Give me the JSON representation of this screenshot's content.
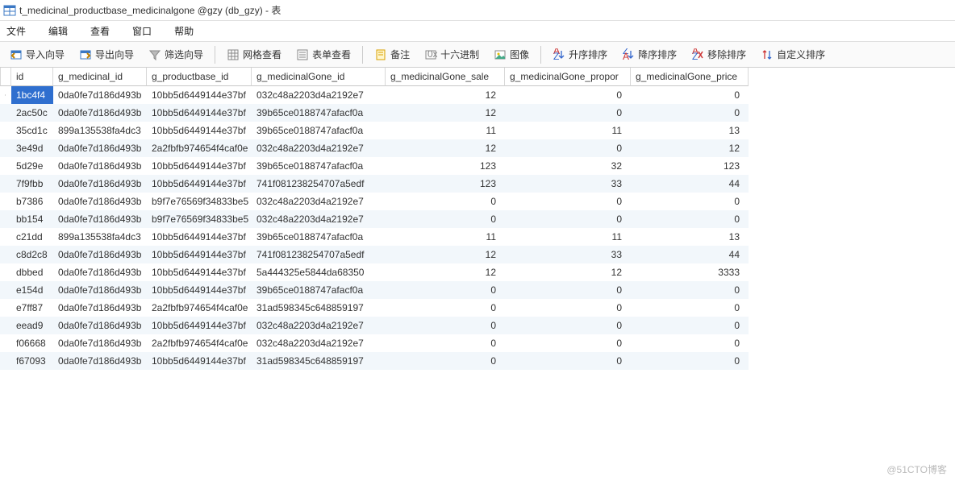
{
  "title": "t_medicinal_productbase_medicinalgone @gzy (db_gzy) - 表",
  "menu": {
    "file": "文件",
    "edit": "编辑",
    "view": "查看",
    "window": "窗口",
    "help": "帮助"
  },
  "toolbar": {
    "import": "导入向导",
    "export": "导出向导",
    "filter": "筛选向导",
    "gridview": "网格查看",
    "formview": "表单查看",
    "memo": "备注",
    "hex": "十六进制",
    "image": "图像",
    "asc": "升序排序",
    "desc": "降序排序",
    "remove_sort": "移除排序",
    "custom_sort": "自定义排序"
  },
  "columns": [
    "",
    "id",
    "g_medicinal_id",
    "g_productbase_id",
    "g_medicinalGone_id",
    "g_medicinalGone_sale",
    "g_medicinalGone_propor",
    "g_medicinalGone_price"
  ],
  "selected_cell": {
    "row": 0,
    "col": 1
  },
  "rows": [
    {
      "id": "1bc4f4",
      "g_medicinal_id": "0da0fe7d186d493b",
      "g_productbase_id": "10bb5d6449144e37bf",
      "g_medicinalGone_id": "032c48a2203d4a2192e7",
      "sale": "12",
      "propor": "0",
      "price": "0",
      "indicator": true
    },
    {
      "id": "2ac50c",
      "g_medicinal_id": "0da0fe7d186d493b",
      "g_productbase_id": "10bb5d6449144e37bf",
      "g_medicinalGone_id": "39b65ce0188747afacf0a",
      "sale": "12",
      "propor": "0",
      "price": "0"
    },
    {
      "id": "35cd1c",
      "g_medicinal_id": "899a135538fa4dc3",
      "g_productbase_id": "10bb5d6449144e37bf",
      "g_medicinalGone_id": "39b65ce0188747afacf0a",
      "sale": "11",
      "propor": "11",
      "price": "13"
    },
    {
      "id": "3e49d",
      "g_medicinal_id": "0da0fe7d186d493b",
      "g_productbase_id": "2a2fbfb974654f4caf0e",
      "g_medicinalGone_id": "032c48a2203d4a2192e7",
      "sale": "12",
      "propor": "0",
      "price": "12"
    },
    {
      "id": "5d29e",
      "g_medicinal_id": "0da0fe7d186d493b",
      "g_productbase_id": "10bb5d6449144e37bf",
      "g_medicinalGone_id": "39b65ce0188747afacf0a",
      "sale": "123",
      "propor": "32",
      "price": "123"
    },
    {
      "id": "7f9fbb",
      "g_medicinal_id": "0da0fe7d186d493b",
      "g_productbase_id": "10bb5d6449144e37bf",
      "g_medicinalGone_id": "741f081238254707a5edf",
      "sale": "123",
      "propor": "33",
      "price": "44"
    },
    {
      "id": "b7386",
      "g_medicinal_id": "0da0fe7d186d493b",
      "g_productbase_id": "b9f7e76569f34833be5",
      "g_medicinalGone_id": "032c48a2203d4a2192e7",
      "sale": "0",
      "propor": "0",
      "price": "0"
    },
    {
      "id": "bb154",
      "g_medicinal_id": "0da0fe7d186d493b",
      "g_productbase_id": "b9f7e76569f34833be5",
      "g_medicinalGone_id": "032c48a2203d4a2192e7",
      "sale": "0",
      "propor": "0",
      "price": "0"
    },
    {
      "id": "c21dd",
      "g_medicinal_id": "899a135538fa4dc3",
      "g_productbase_id": "10bb5d6449144e37bf",
      "g_medicinalGone_id": "39b65ce0188747afacf0a",
      "sale": "11",
      "propor": "11",
      "price": "13"
    },
    {
      "id": "c8d2c8",
      "g_medicinal_id": "0da0fe7d186d493b",
      "g_productbase_id": "10bb5d6449144e37bf",
      "g_medicinalGone_id": "741f081238254707a5edf",
      "sale": "12",
      "propor": "33",
      "price": "44"
    },
    {
      "id": "dbbed",
      "g_medicinal_id": "0da0fe7d186d493b",
      "g_productbase_id": "10bb5d6449144e37bf",
      "g_medicinalGone_id": "5a444325e5844da68350",
      "sale": "12",
      "propor": "12",
      "price": "3333"
    },
    {
      "id": "e154d",
      "g_medicinal_id": "0da0fe7d186d493b",
      "g_productbase_id": "10bb5d6449144e37bf",
      "g_medicinalGone_id": "39b65ce0188747afacf0a",
      "sale": "0",
      "propor": "0",
      "price": "0"
    },
    {
      "id": "e7ff87",
      "g_medicinal_id": "0da0fe7d186d493b",
      "g_productbase_id": "2a2fbfb974654f4caf0e",
      "g_medicinalGone_id": "31ad598345c648859197",
      "sale": "0",
      "propor": "0",
      "price": "0"
    },
    {
      "id": "eead9",
      "g_medicinal_id": "0da0fe7d186d493b",
      "g_productbase_id": "10bb5d6449144e37bf",
      "g_medicinalGone_id": "032c48a2203d4a2192e7",
      "sale": "0",
      "propor": "0",
      "price": "0"
    },
    {
      "id": "f06668",
      "g_medicinal_id": "0da0fe7d186d493b",
      "g_productbase_id": "2a2fbfb974654f4caf0e",
      "g_medicinalGone_id": "032c48a2203d4a2192e7",
      "sale": "0",
      "propor": "0",
      "price": "0"
    },
    {
      "id": "f67093",
      "g_medicinal_id": "0da0fe7d186d493b",
      "g_productbase_id": "10bb5d6449144e37bf",
      "g_medicinalGone_id": "31ad598345c648859197",
      "sale": "0",
      "propor": "0",
      "price": "0"
    }
  ],
  "watermark": "@51CTO博客"
}
